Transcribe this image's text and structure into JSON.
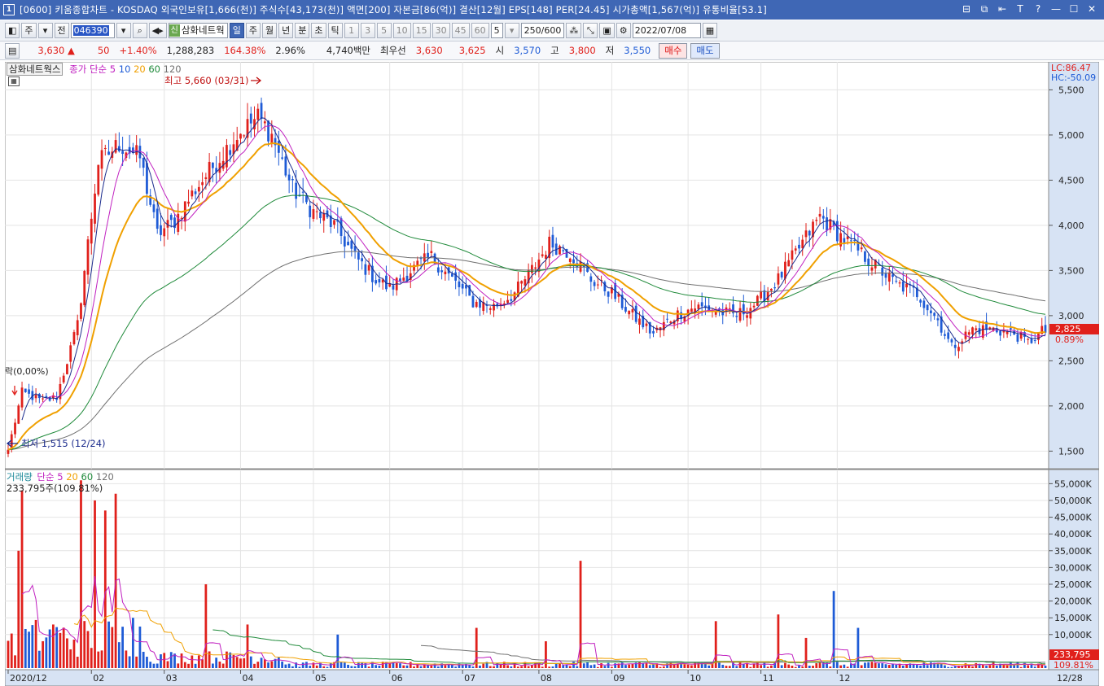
{
  "window": {
    "icon_label": "1",
    "title": "[0600] 키움종합차트 - KOSDAQ 외국인보유[1,666(천)] 주식수[43,173(천)] 액면[200] 자본금[86(억)] 결산[12월] EPS[148] PER[24.45] 시가총액[1,567(억)] 유통비율[53.1]",
    "controls": [
      "⊟",
      "⧉",
      "⇤",
      "T",
      "?",
      "—",
      "☐",
      "✕"
    ]
  },
  "toolbar": {
    "period_type": "주",
    "scope": "전",
    "code": "046390",
    "stock_name": "삼화네트웍",
    "stock_badge": "신",
    "intervals": [
      "일",
      "주",
      "월",
      "년",
      "분",
      "초",
      "틱"
    ],
    "active_interval": "일",
    "minutes": [
      "1",
      "3",
      "5",
      "10",
      "15",
      "30",
      "45",
      "60"
    ],
    "minute_select": "5",
    "count": "250",
    "count_max": "/600",
    "date": "2022/07/08"
  },
  "quote": {
    "price": "3,630",
    "change_arrow": "▲",
    "change": "50",
    "change_pct": "+1.40%",
    "volume": "1,288,283",
    "volume_ratio": "164.38%",
    "turnover": "2.96%",
    "amount": "4,740백만",
    "best_label": "최우선",
    "best_ask": "3,630",
    "best_bid": "3,625",
    "open_label": "시",
    "open": "3,570",
    "high_label": "고",
    "high": "3,800",
    "low_label": "저",
    "low": "3,550",
    "buy_label": "매수",
    "sell_label": "매도"
  },
  "price_panel": {
    "stock_label": "삼화네트웍스",
    "ma_label": "종가 단순",
    "ma_periods": [
      "5",
      "10",
      "20",
      "60",
      "120"
    ],
    "max_marker": "최고 5,660 (03/31)",
    "min_marker": "최저 1,515 (12/24)",
    "start_marker": "락(0,00%)",
    "lc": "LC:86.47",
    "hc": "HC:-50.09",
    "last_price": "2,825",
    "last_pct": "0.89%"
  },
  "volume_panel": {
    "label": "거래량",
    "ma_label": "단순",
    "ma_periods": [
      "5",
      "20",
      "60",
      "120"
    ],
    "last_volume_info": "233,795주(109.81%)",
    "last_value": "233,795",
    "last_pct": "109.81%"
  },
  "date_axis": {
    "labels": [
      "2020/12",
      "02",
      "03",
      "04",
      "05",
      "06",
      "07",
      "08",
      "09",
      "10",
      "11",
      "12"
    ],
    "right_label": "12/28"
  },
  "colors": {
    "up": "#e0201b",
    "down": "#1e5bd6",
    "ma5": "#1a2a8c",
    "ma10": "#c020c0",
    "ma20": "#f0a000",
    "ma60": "#1f8a3a",
    "ma120": "#707070",
    "axis_bg": "#d7e3f4",
    "title_bar": "#3f67b5"
  },
  "chart_data": [
    {
      "type": "candlestick",
      "title": "삼화네트웍스",
      "y_ticks": [
        "1,500",
        "2,000",
        "2,500",
        "3,000",
        "3,500",
        "4,000",
        "4,500",
        "5,000",
        "5,500"
      ],
      "ylim": [
        1350,
        5720
      ],
      "x_range_months": [
        "2020/12",
        "2021/12"
      ],
      "close_path": [
        [
          0,
          1515
        ],
        [
          4,
          2150
        ],
        [
          10,
          2050
        ],
        [
          14,
          2100
        ],
        [
          20,
          2900
        ],
        [
          26,
          4700
        ],
        [
          32,
          4900
        ],
        [
          38,
          4750
        ],
        [
          43,
          3900
        ],
        [
          48,
          4050
        ],
        [
          54,
          4400
        ],
        [
          60,
          4700
        ],
        [
          66,
          5000
        ],
        [
          72,
          5200
        ],
        [
          76,
          5000
        ],
        [
          82,
          4400
        ],
        [
          88,
          4150
        ],
        [
          94,
          4000
        ],
        [
          100,
          3650
        ],
        [
          106,
          3400
        ],
        [
          110,
          3300
        ],
        [
          116,
          3500
        ],
        [
          122,
          3650
        ],
        [
          128,
          3400
        ],
        [
          134,
          3150
        ],
        [
          140,
          3100
        ],
        [
          146,
          3250
        ],
        [
          150,
          3450
        ],
        [
          156,
          3800
        ],
        [
          162,
          3700
        ],
        [
          168,
          3400
        ],
        [
          174,
          3250
        ],
        [
          180,
          3000
        ],
        [
          186,
          2800
        ],
        [
          192,
          3000
        ],
        [
          198,
          3100
        ],
        [
          204,
          3050
        ],
        [
          210,
          3000
        ],
        [
          216,
          3150
        ],
        [
          222,
          3400
        ],
        [
          228,
          3750
        ],
        [
          234,
          4100
        ],
        [
          238,
          3950
        ],
        [
          244,
          3750
        ],
        [
          250,
          3550
        ],
        [
          256,
          3350
        ],
        [
          262,
          3250
        ],
        [
          268,
          2950
        ],
        [
          272,
          2650
        ],
        [
          278,
          2850
        ],
        [
          284,
          2850
        ],
        [
          290,
          2800
        ],
        [
          294,
          2700
        ],
        [
          298,
          2825
        ]
      ]
    },
    {
      "type": "bar",
      "title": "거래량",
      "y_ticks": [
        "10,000K",
        "15,000K",
        "20,000K",
        "25,000K",
        "30,000K",
        "35,000K",
        "40,000K",
        "45,000K",
        "50,000K",
        "55,000K"
      ],
      "ylim": [
        0,
        58000
      ],
      "spikes": [
        {
          "i": 3,
          "v": 35000
        },
        {
          "i": 4,
          "v": 53000
        },
        {
          "i": 13,
          "v": 13000
        },
        {
          "i": 21,
          "v": 56000
        },
        {
          "i": 25,
          "v": 50000
        },
        {
          "i": 28,
          "v": 47000
        },
        {
          "i": 31,
          "v": 52000
        },
        {
          "i": 36,
          "v": 15000
        },
        {
          "i": 57,
          "v": 25000
        },
        {
          "i": 69,
          "v": 13000
        },
        {
          "i": 95,
          "v": 10000
        },
        {
          "i": 135,
          "v": 12000
        },
        {
          "i": 155,
          "v": 8000
        },
        {
          "i": 165,
          "v": 32000
        },
        {
          "i": 204,
          "v": 14000
        },
        {
          "i": 222,
          "v": 16000
        },
        {
          "i": 230,
          "v": 9000
        },
        {
          "i": 238,
          "v": 23000
        },
        {
          "i": 245,
          "v": 12000
        }
      ]
    }
  ]
}
